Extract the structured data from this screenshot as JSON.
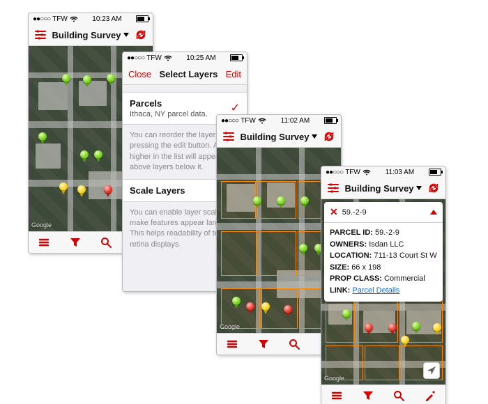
{
  "carrier": "TFW",
  "times": {
    "p1": "10:23 AM",
    "p2": "10:25 AM",
    "p3": "11:02 AM",
    "p4": "11:03 AM"
  },
  "header": {
    "title": "Building Survey",
    "dropdown_icon": "chevron-down-icon"
  },
  "map_attribution": "Google",
  "layers": {
    "close": "Close",
    "title": "Select Layers",
    "edit": "Edit",
    "parcels": {
      "title": "Parcels",
      "subtitle": "Ithaca, NY parcel data."
    },
    "reorder_hint": "You can reorder the layers by pressing the edit button. A layer higher in the list will appear above layers below it.",
    "scale_header": "Scale Layers",
    "scale_hint": "You can enable layer scaling to make features appear larger. This helps readability of text on retina displays."
  },
  "detail": {
    "short_id": "59.-2-9",
    "labels": {
      "parcel_id": "PARCEL ID:",
      "owners": "OWNERS:",
      "location": "LOCATION:",
      "size": "SIZE:",
      "prop_class": "PROP CLASS:",
      "link": "LINK:"
    },
    "values": {
      "parcel_id": "59.-2-9",
      "owners": "Isdan LLC",
      "location": "711-13 Court St W",
      "size": "66 x 198",
      "prop_class": "Commercial",
      "link": "Parcel Details"
    }
  }
}
